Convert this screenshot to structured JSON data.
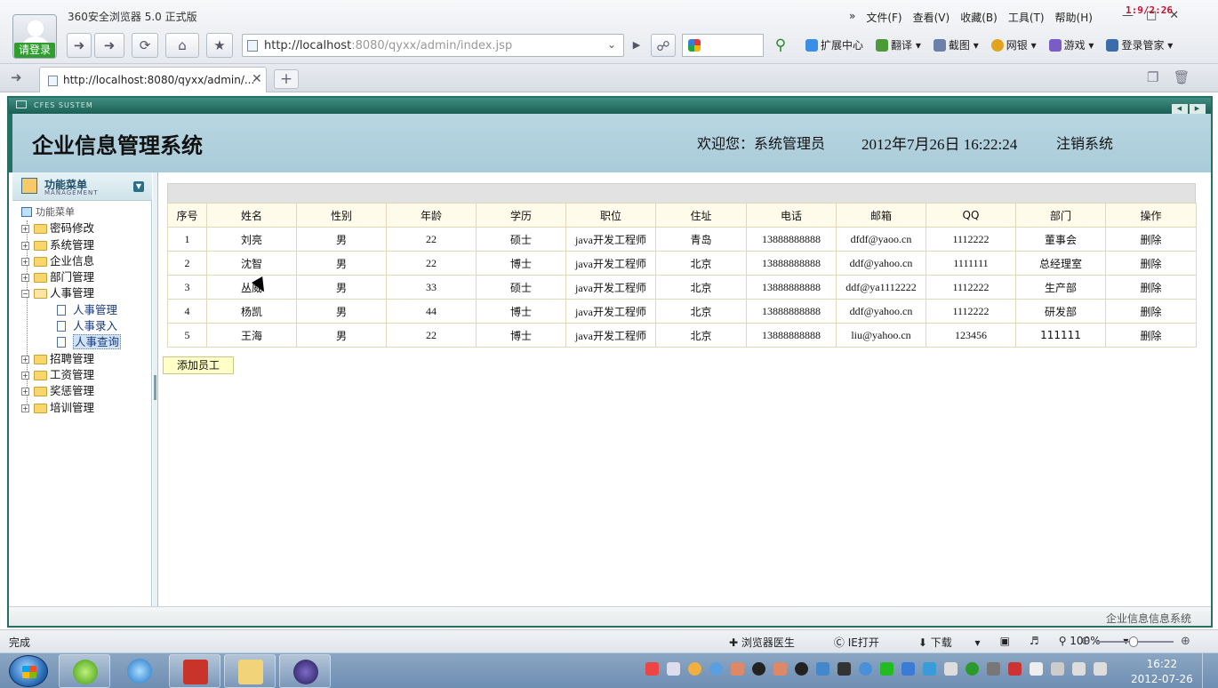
{
  "browser": {
    "title": "360安全浏览器 5.0 正式版",
    "login_label": "请登录",
    "menu": [
      "»",
      "文件(F)",
      "查看(V)",
      "收藏(B)",
      "工具(T)",
      "帮助(H)"
    ],
    "overlay_clock": "1:9/2:26",
    "url_host": "http://localhost",
    "url_rest": ":8080/qyxx/admin/index.jsp",
    "toolbar": [
      "扩展中心",
      "翻译",
      "截图",
      "网银",
      "游戏",
      "登录管家"
    ],
    "tab_title": "http://localhost:8080/qyxx/admin/...",
    "status_text": "完成",
    "status_items": [
      "浏览器医生",
      "IE打开",
      "下载"
    ],
    "zoom": "100%"
  },
  "app": {
    "system_bar": "CFES SUSTEM",
    "title": "企业信息管理系统",
    "welcome": "欢迎您：系统管理员",
    "datetime": "2012年7月26日  16:22:24",
    "logout": "注销系统",
    "footer": "企业信息信息系统"
  },
  "menu": {
    "title": "功能菜单",
    "subtitle": "MANAGEMENT",
    "root": "功能菜单",
    "items": [
      {
        "label": "密码修改"
      },
      {
        "label": "系统管理"
      },
      {
        "label": "企业信息"
      },
      {
        "label": "部门管理"
      },
      {
        "label": "人事管理",
        "children": [
          "人事管理",
          "人事录入",
          "人事查询"
        ]
      },
      {
        "label": "招聘管理"
      },
      {
        "label": "工资管理"
      },
      {
        "label": "奖惩管理"
      },
      {
        "label": "培训管理"
      }
    ]
  },
  "table": {
    "headers": [
      "序号",
      "姓名",
      "性别",
      "年龄",
      "学历",
      "职位",
      "住址",
      "电话",
      "邮箱",
      "QQ",
      "部门",
      "操作"
    ],
    "rows": [
      [
        "1",
        "刘亮",
        "男",
        "22",
        "硕士",
        "java开发工程师",
        "青岛",
        "13888888888",
        "dfdf@yaoo.cn",
        "1112222",
        "董事会",
        "删除"
      ],
      [
        "2",
        "沈智",
        "男",
        "22",
        "博士",
        "java开发工程师",
        "北京",
        "13888888888",
        "ddf@yahoo.cn",
        "1111111",
        "总经理室",
        "删除"
      ],
      [
        "3",
        "丛威",
        "男",
        "33",
        "硕士",
        "java开发工程师",
        "北京",
        "13888888888",
        "ddf@ya1112222",
        "1112222",
        "生产部",
        "删除"
      ],
      [
        "4",
        "杨凯",
        "男",
        "44",
        "博士",
        "java开发工程师",
        "北京",
        "13888888888",
        "ddf@yahoo.cn",
        "1112222",
        "研发部",
        "删除"
      ],
      [
        "5",
        "王海",
        "男",
        "22",
        "博士",
        "java开发工程师",
        "北京",
        "13888888888",
        "liu@yahoo.cn",
        "123456",
        "111111",
        "删除"
      ]
    ],
    "add_button": "添加员工"
  },
  "taskbar": {
    "time": "16:22",
    "date": "2012-07-26"
  }
}
